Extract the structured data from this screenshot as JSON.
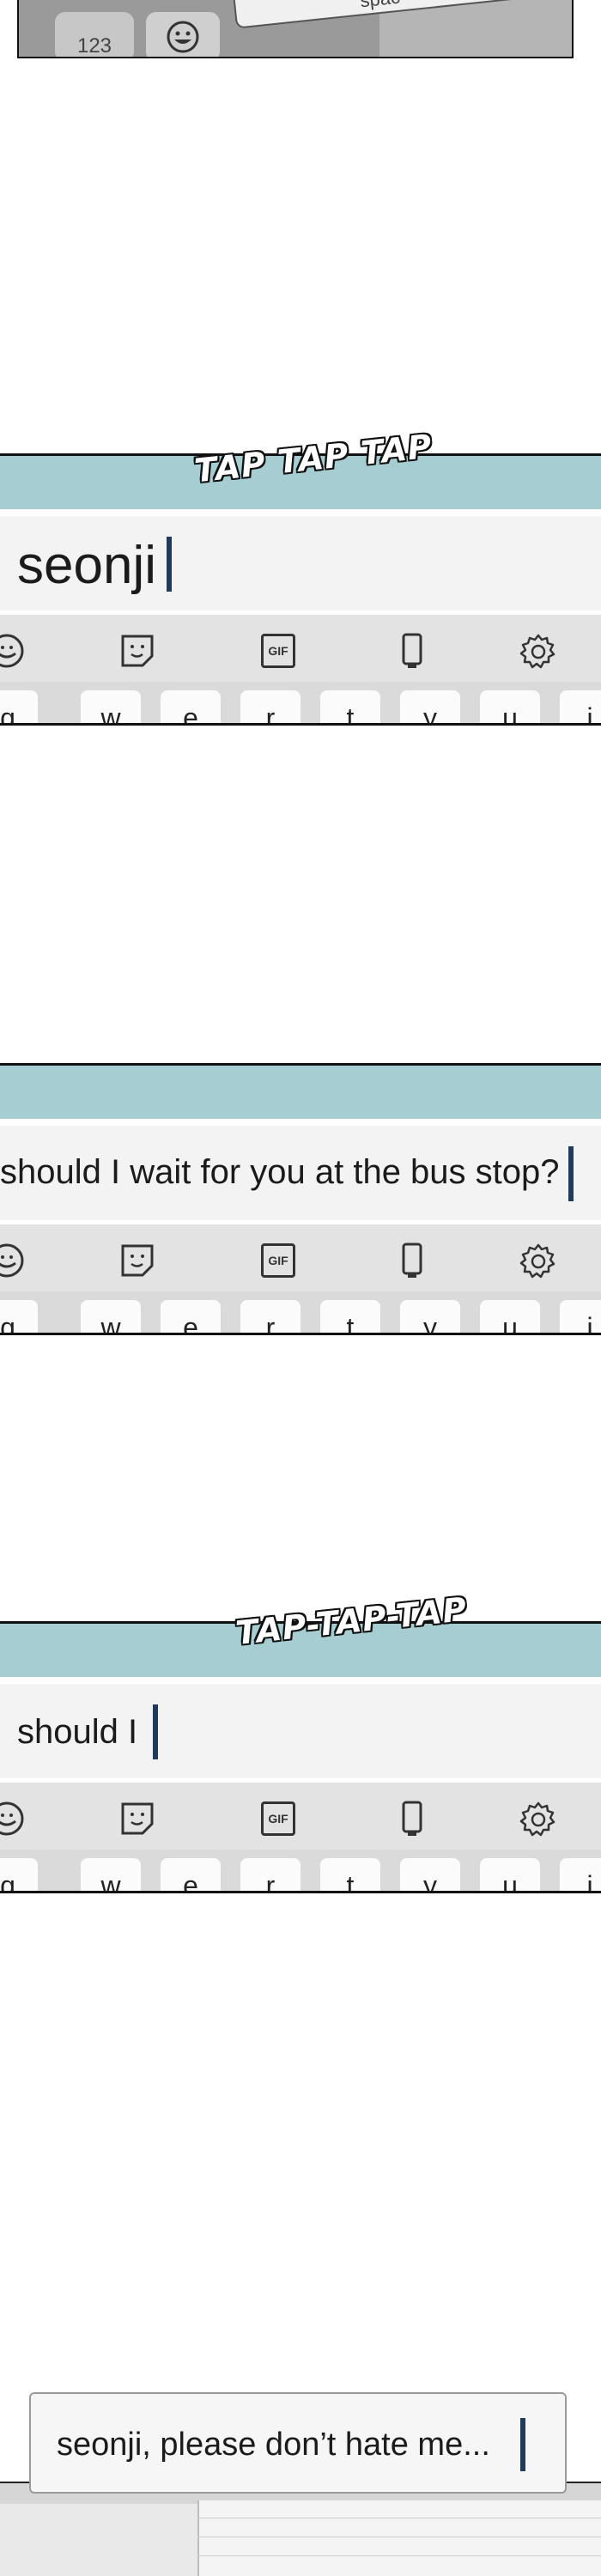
{
  "top_panel": {
    "key_123": "123",
    "space_label": "spac"
  },
  "panels": [
    {
      "id": "panel-1",
      "sfx": "TAP TAP TAP",
      "typed_text": "seonji",
      "keys": [
        "q",
        "w",
        "e",
        "r",
        "t",
        "y",
        "u",
        "i"
      ]
    },
    {
      "id": "panel-2",
      "sfx": "",
      "typed_text": "should I wait for you at the bus stop?",
      "keys": [
        "q",
        "w",
        "e",
        "r",
        "t",
        "y",
        "u",
        "i"
      ]
    },
    {
      "id": "panel-3",
      "sfx": "TAP-TAP-TAP",
      "typed_text": "should I",
      "keys": [
        "q",
        "w",
        "e",
        "r",
        "t",
        "y",
        "u",
        "i"
      ]
    }
  ],
  "toolbar": {
    "gif_label": "GIF",
    "icons": [
      "emoji-icon",
      "sticker-icon",
      "gif-icon",
      "phone-icon",
      "gear-icon"
    ]
  },
  "final_message": {
    "text": "seonji, please don’t hate me..."
  },
  "colors": {
    "teal_bar": "#a5cdd2",
    "cursor": "#1f3a5a",
    "input_bg": "#f3f3f3",
    "toolbar_bg": "#e3e3e3"
  }
}
